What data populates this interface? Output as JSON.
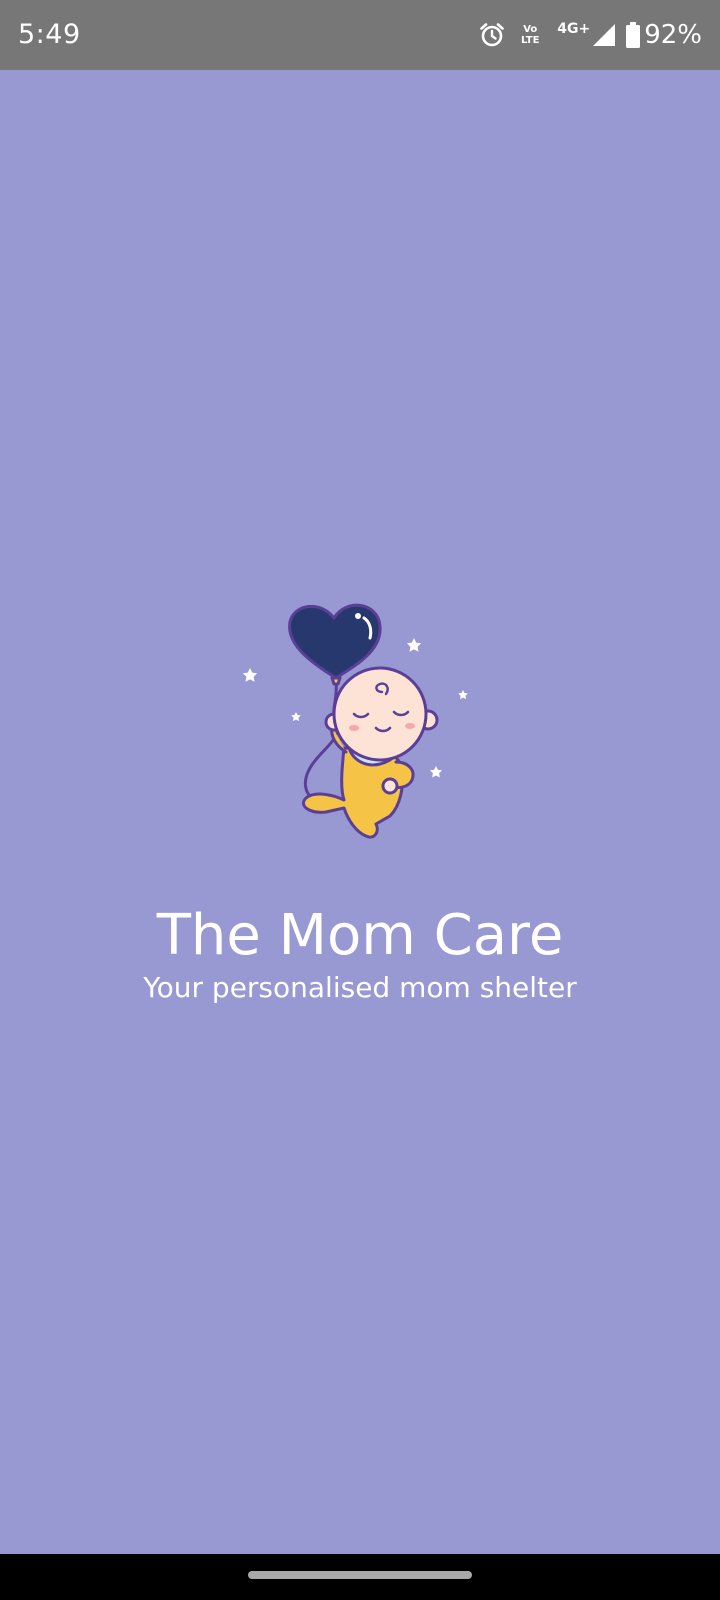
{
  "status_bar": {
    "time": "5:49",
    "volte_label_top": "Vo",
    "volte_label_bottom": "LTE",
    "network_type": "4G+",
    "battery_percent": "92%",
    "icons": [
      "alarm-icon",
      "volte-icon",
      "signal-icon",
      "battery-icon"
    ]
  },
  "splash": {
    "title": "The Mom Care",
    "tagline": "Your personalised mom shelter",
    "illustration": "baby-with-heart-balloon"
  },
  "colors": {
    "background": "#9898d2",
    "status_bar": "#777777",
    "nav_bar": "#000000",
    "text": "#ffffff",
    "balloon": "#26386e",
    "outline": "#5b3f96",
    "suit": "#f5c346",
    "skin": "#fde2d6",
    "bib": "#cfe3f7"
  }
}
